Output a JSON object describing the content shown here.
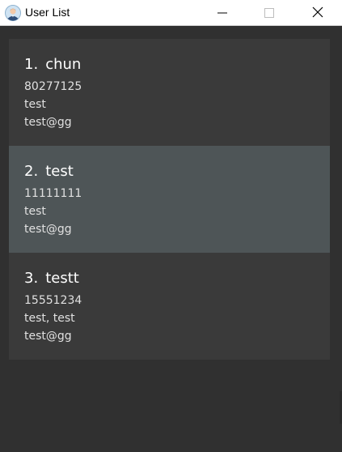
{
  "window": {
    "title": "User List",
    "icons": {
      "app": "user-avatar-icon",
      "minimize": "minimize-icon",
      "maximize": "maximize-icon",
      "close": "close-icon"
    }
  },
  "users": [
    {
      "index": "1.",
      "name": "chun",
      "phone": "80277125",
      "tags": "test",
      "email": "test@gg",
      "selected": false
    },
    {
      "index": "2.",
      "name": "test",
      "phone": "11111111",
      "tags": "test",
      "email": "test@gg",
      "selected": true
    },
    {
      "index": "3.",
      "name": "testt",
      "phone": "15551234",
      "tags": "test, test",
      "email": "test@gg",
      "selected": false
    }
  ],
  "colors": {
    "background": "#303030",
    "card": "#393939",
    "selected_card": "#4e5557",
    "text": "#ffffff"
  }
}
